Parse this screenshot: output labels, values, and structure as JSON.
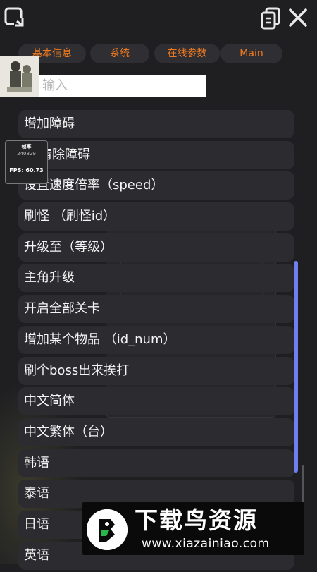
{
  "tabs": [
    {
      "label": "基本信息"
    },
    {
      "label": "系统"
    },
    {
      "label": "在线参数"
    },
    {
      "label": "Main"
    }
  ],
  "search": {
    "placeholder_visible": "输入"
  },
  "fps_overlay": {
    "label": "帧率",
    "frame_count": "240829",
    "fps": "FPS: 60.73"
  },
  "menu_items": [
    {
      "label": "增加障碍"
    },
    {
      "label": "清除障碍"
    },
    {
      "label": "设置速度倍率（speed）"
    },
    {
      "label": "刷怪 （刷怪id）"
    },
    {
      "label": "升级至（等级）"
    },
    {
      "label": "主角升级"
    },
    {
      "label": "开启全部关卡"
    },
    {
      "label": "增加某个物品 （id_num）"
    },
    {
      "label": "刷个boss出来挨打"
    },
    {
      "label": "中文简体"
    },
    {
      "label": "中文繁体（台）"
    },
    {
      "label": "韩语"
    },
    {
      "label": "泰语"
    },
    {
      "label": "日语"
    },
    {
      "label": "英语"
    }
  ],
  "watermark": {
    "title": "下载鸟资源",
    "url": "www.xiazainiao.com"
  },
  "colors": {
    "accent": "#f07a1f",
    "scrollbar": "#6f7ff2",
    "item_bg": "#2b2b30"
  },
  "icons": {
    "rotate": "rotate-screen-icon",
    "copy": "copy-icon",
    "close": "close-icon"
  }
}
